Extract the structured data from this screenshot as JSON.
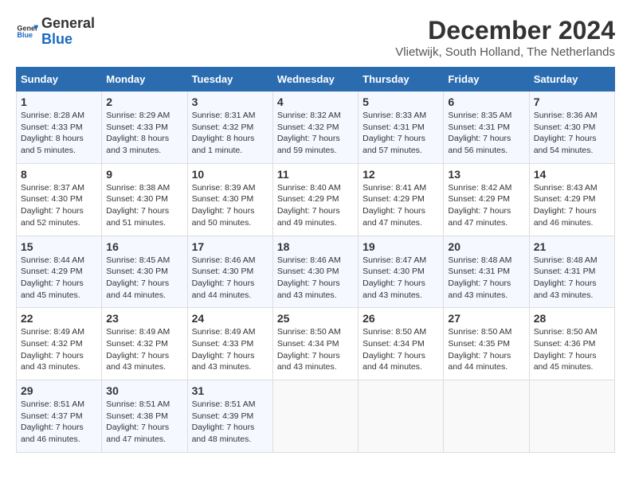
{
  "header": {
    "logo_general": "General",
    "logo_blue": "Blue",
    "month_title": "December 2024",
    "location": "Vlietwijk, South Holland, The Netherlands"
  },
  "weekdays": [
    "Sunday",
    "Monday",
    "Tuesday",
    "Wednesday",
    "Thursday",
    "Friday",
    "Saturday"
  ],
  "weeks": [
    [
      {
        "day": "1",
        "sunrise": "8:28 AM",
        "sunset": "4:33 PM",
        "daylight": "8 hours and 5 minutes."
      },
      {
        "day": "2",
        "sunrise": "8:29 AM",
        "sunset": "4:33 PM",
        "daylight": "8 hours and 3 minutes."
      },
      {
        "day": "3",
        "sunrise": "8:31 AM",
        "sunset": "4:32 PM",
        "daylight": "8 hours and 1 minute."
      },
      {
        "day": "4",
        "sunrise": "8:32 AM",
        "sunset": "4:32 PM",
        "daylight": "7 hours and 59 minutes."
      },
      {
        "day": "5",
        "sunrise": "8:33 AM",
        "sunset": "4:31 PM",
        "daylight": "7 hours and 57 minutes."
      },
      {
        "day": "6",
        "sunrise": "8:35 AM",
        "sunset": "4:31 PM",
        "daylight": "7 hours and 56 minutes."
      },
      {
        "day": "7",
        "sunrise": "8:36 AM",
        "sunset": "4:30 PM",
        "daylight": "7 hours and 54 minutes."
      }
    ],
    [
      {
        "day": "8",
        "sunrise": "8:37 AM",
        "sunset": "4:30 PM",
        "daylight": "7 hours and 52 minutes."
      },
      {
        "day": "9",
        "sunrise": "8:38 AM",
        "sunset": "4:30 PM",
        "daylight": "7 hours and 51 minutes."
      },
      {
        "day": "10",
        "sunrise": "8:39 AM",
        "sunset": "4:30 PM",
        "daylight": "7 hours and 50 minutes."
      },
      {
        "day": "11",
        "sunrise": "8:40 AM",
        "sunset": "4:29 PM",
        "daylight": "7 hours and 49 minutes."
      },
      {
        "day": "12",
        "sunrise": "8:41 AM",
        "sunset": "4:29 PM",
        "daylight": "7 hours and 47 minutes."
      },
      {
        "day": "13",
        "sunrise": "8:42 AM",
        "sunset": "4:29 PM",
        "daylight": "7 hours and 47 minutes."
      },
      {
        "day": "14",
        "sunrise": "8:43 AM",
        "sunset": "4:29 PM",
        "daylight": "7 hours and 46 minutes."
      }
    ],
    [
      {
        "day": "15",
        "sunrise": "8:44 AM",
        "sunset": "4:29 PM",
        "daylight": "7 hours and 45 minutes."
      },
      {
        "day": "16",
        "sunrise": "8:45 AM",
        "sunset": "4:30 PM",
        "daylight": "7 hours and 44 minutes."
      },
      {
        "day": "17",
        "sunrise": "8:46 AM",
        "sunset": "4:30 PM",
        "daylight": "7 hours and 44 minutes."
      },
      {
        "day": "18",
        "sunrise": "8:46 AM",
        "sunset": "4:30 PM",
        "daylight": "7 hours and 43 minutes."
      },
      {
        "day": "19",
        "sunrise": "8:47 AM",
        "sunset": "4:30 PM",
        "daylight": "7 hours and 43 minutes."
      },
      {
        "day": "20",
        "sunrise": "8:48 AM",
        "sunset": "4:31 PM",
        "daylight": "7 hours and 43 minutes."
      },
      {
        "day": "21",
        "sunrise": "8:48 AM",
        "sunset": "4:31 PM",
        "daylight": "7 hours and 43 minutes."
      }
    ],
    [
      {
        "day": "22",
        "sunrise": "8:49 AM",
        "sunset": "4:32 PM",
        "daylight": "7 hours and 43 minutes."
      },
      {
        "day": "23",
        "sunrise": "8:49 AM",
        "sunset": "4:32 PM",
        "daylight": "7 hours and 43 minutes."
      },
      {
        "day": "24",
        "sunrise": "8:49 AM",
        "sunset": "4:33 PM",
        "daylight": "7 hours and 43 minutes."
      },
      {
        "day": "25",
        "sunrise": "8:50 AM",
        "sunset": "4:34 PM",
        "daylight": "7 hours and 43 minutes."
      },
      {
        "day": "26",
        "sunrise": "8:50 AM",
        "sunset": "4:34 PM",
        "daylight": "7 hours and 44 minutes."
      },
      {
        "day": "27",
        "sunrise": "8:50 AM",
        "sunset": "4:35 PM",
        "daylight": "7 hours and 44 minutes."
      },
      {
        "day": "28",
        "sunrise": "8:50 AM",
        "sunset": "4:36 PM",
        "daylight": "7 hours and 45 minutes."
      }
    ],
    [
      {
        "day": "29",
        "sunrise": "8:51 AM",
        "sunset": "4:37 PM",
        "daylight": "7 hours and 46 minutes."
      },
      {
        "day": "30",
        "sunrise": "8:51 AM",
        "sunset": "4:38 PM",
        "daylight": "7 hours and 47 minutes."
      },
      {
        "day": "31",
        "sunrise": "8:51 AM",
        "sunset": "4:39 PM",
        "daylight": "7 hours and 48 minutes."
      },
      null,
      null,
      null,
      null
    ]
  ],
  "labels": {
    "sunrise": "Sunrise:",
    "sunset": "Sunset:",
    "daylight": "Daylight:"
  }
}
